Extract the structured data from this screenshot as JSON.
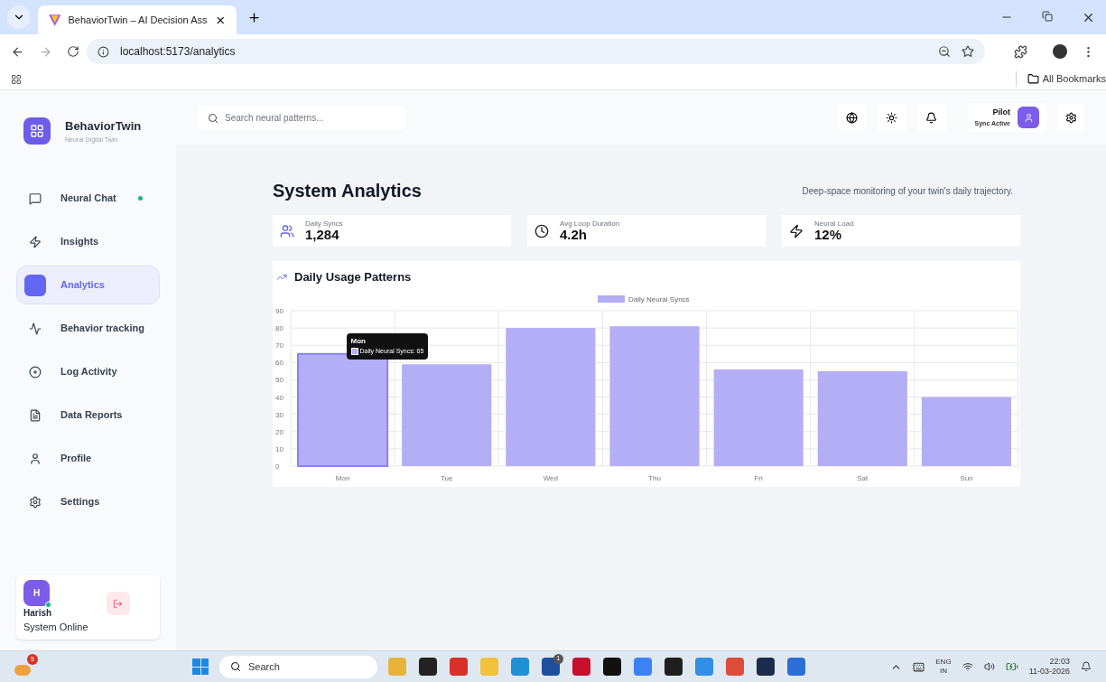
{
  "browser": {
    "tab_title": "BehaviorTwin – AI Decision Ass",
    "url": "localhost:5173/analytics",
    "bookmarks": "All Bookmarks"
  },
  "brand": {
    "name": "BehaviorTwin",
    "tagline": "Neural Digital Twin"
  },
  "sidebar": {
    "items": [
      {
        "label": "Neural Chat",
        "kind": "chat",
        "selected": false,
        "online": true
      },
      {
        "label": "Insights",
        "kind": "bolt",
        "selected": false,
        "online": false
      },
      {
        "label": "Analytics",
        "kind": "square",
        "selected": true,
        "online": false
      },
      {
        "label": "Behavior tracking",
        "kind": "pulse",
        "selected": false,
        "online": false
      },
      {
        "label": "Log Activity",
        "kind": "target",
        "selected": false,
        "online": false
      },
      {
        "label": "Data Reports",
        "kind": "file",
        "selected": false,
        "online": false
      },
      {
        "label": "Profile",
        "kind": "user",
        "selected": false,
        "online": false
      },
      {
        "label": "Settings",
        "kind": "gear",
        "selected": false,
        "online": false
      }
    ],
    "user": {
      "initial": "H",
      "name": "Harish",
      "status": "System Online",
      "online": true
    }
  },
  "header": {
    "search": {
      "placeholder": "Search neural patterns..."
    },
    "user": {
      "name": "Pilot",
      "status": "Sync Active"
    }
  },
  "page": {
    "title": "System Analytics",
    "subtitle": "Deep-space monitoring of your twin's daily trajectory."
  },
  "stats": [
    {
      "label": "Daily Syncs",
      "value": "1,284",
      "kind": "users"
    },
    {
      "label": "Avg Loop Duration",
      "value": "4.2h",
      "kind": "clock"
    },
    {
      "label": "Neural Load",
      "value": "12%",
      "kind": "bolt"
    }
  ],
  "chart": {
    "title": "Daily Usage Patterns",
    "tooltip": {
      "title": "Mon",
      "text": "Daily Neural Syncs: 65"
    },
    "bar_states": [
      {
        "hovered": true
      },
      {
        "hovered": false
      },
      {
        "hovered": false
      },
      {
        "hovered": false
      },
      {
        "hovered": false
      },
      {
        "hovered": false
      },
      {
        "hovered": false
      }
    ],
    "chart_data": {
      "type": "bar",
      "categories": [
        "Mon",
        "Tue",
        "Wed",
        "Thu",
        "Fri",
        "Sat",
        "Sun"
      ],
      "series": [
        {
          "name": "Daily Neural Syncs",
          "color": "#b3aef5",
          "values": [
            65,
            59,
            80,
            81,
            56,
            55,
            40
          ]
        }
      ],
      "grid": true,
      "ylim": [
        0,
        90
      ],
      "yticks": [
        0,
        10,
        20,
        30,
        40,
        50,
        60,
        70,
        80,
        90
      ]
    }
  },
  "taskbar": {
    "weather_badge": "5",
    "search": "Search",
    "apps": [
      {
        "color": "#e8b33a"
      },
      {
        "color": "#222222"
      },
      {
        "color": "#d9302a"
      },
      {
        "color": "#f3c23d"
      },
      {
        "color": "#1f8fd6"
      },
      {
        "color": "#1d4f9c",
        "badge": "1"
      },
      {
        "color": "#c8102e"
      },
      {
        "color": "#111111"
      },
      {
        "color": "#3b82f6"
      },
      {
        "color": "#1f1f1f"
      },
      {
        "color": "#2f8ee5"
      },
      {
        "color": "#dd4b39"
      },
      {
        "color": "#1d2b4f"
      },
      {
        "color": "#2b6fd6"
      }
    ],
    "lang": "ENG",
    "region": "IN",
    "time": "22:03",
    "date": "11-03-2026"
  }
}
